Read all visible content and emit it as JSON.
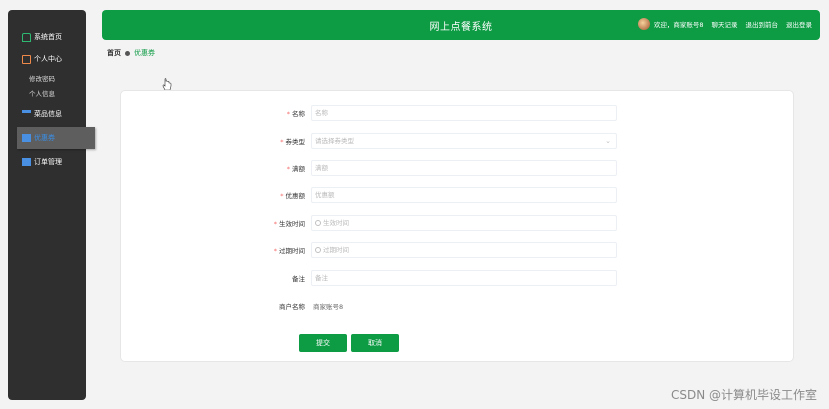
{
  "sidebar": {
    "items": [
      {
        "label": "系统首页",
        "icon": "home-icon"
      },
      {
        "label": "个人中心",
        "icon": "user-icon"
      },
      {
        "label": "修改密码"
      },
      {
        "label": "个人信息"
      },
      {
        "label": "菜品信息",
        "icon": "list-icon"
      },
      {
        "label": "优惠券",
        "icon": "grid-icon",
        "active": true
      },
      {
        "label": "订单管理",
        "icon": "grid-icon"
      }
    ]
  },
  "header": {
    "title": "网上点餐系统",
    "welcome": "欢迎，商家账号8",
    "chat": "聊天记录",
    "front": "退出到前台",
    "logout": "退出登录"
  },
  "breadcrumb": {
    "home": "首页",
    "current": "优惠券"
  },
  "form": {
    "name": {
      "label": "名称",
      "placeholder": "名称"
    },
    "type": {
      "label": "券类型",
      "placeholder": "请选择券类型"
    },
    "threshold": {
      "label": "满额",
      "placeholder": "满额"
    },
    "discount": {
      "label": "优惠额",
      "placeholder": "优惠额"
    },
    "start": {
      "label": "生效时间",
      "placeholder": "生效时间"
    },
    "end": {
      "label": "过期时间",
      "placeholder": "过期时间"
    },
    "remark": {
      "label": "备注",
      "placeholder": "备注"
    },
    "merchant": {
      "label": "商户名称",
      "value": "商家账号8"
    },
    "submit": "提交",
    "cancel": "取消"
  },
  "watermark": "CSDN @计算机毕设工作室",
  "colors": {
    "primary": "#0d9b44",
    "sidebar": "#2f2f2f",
    "required": "#f56c6c"
  }
}
